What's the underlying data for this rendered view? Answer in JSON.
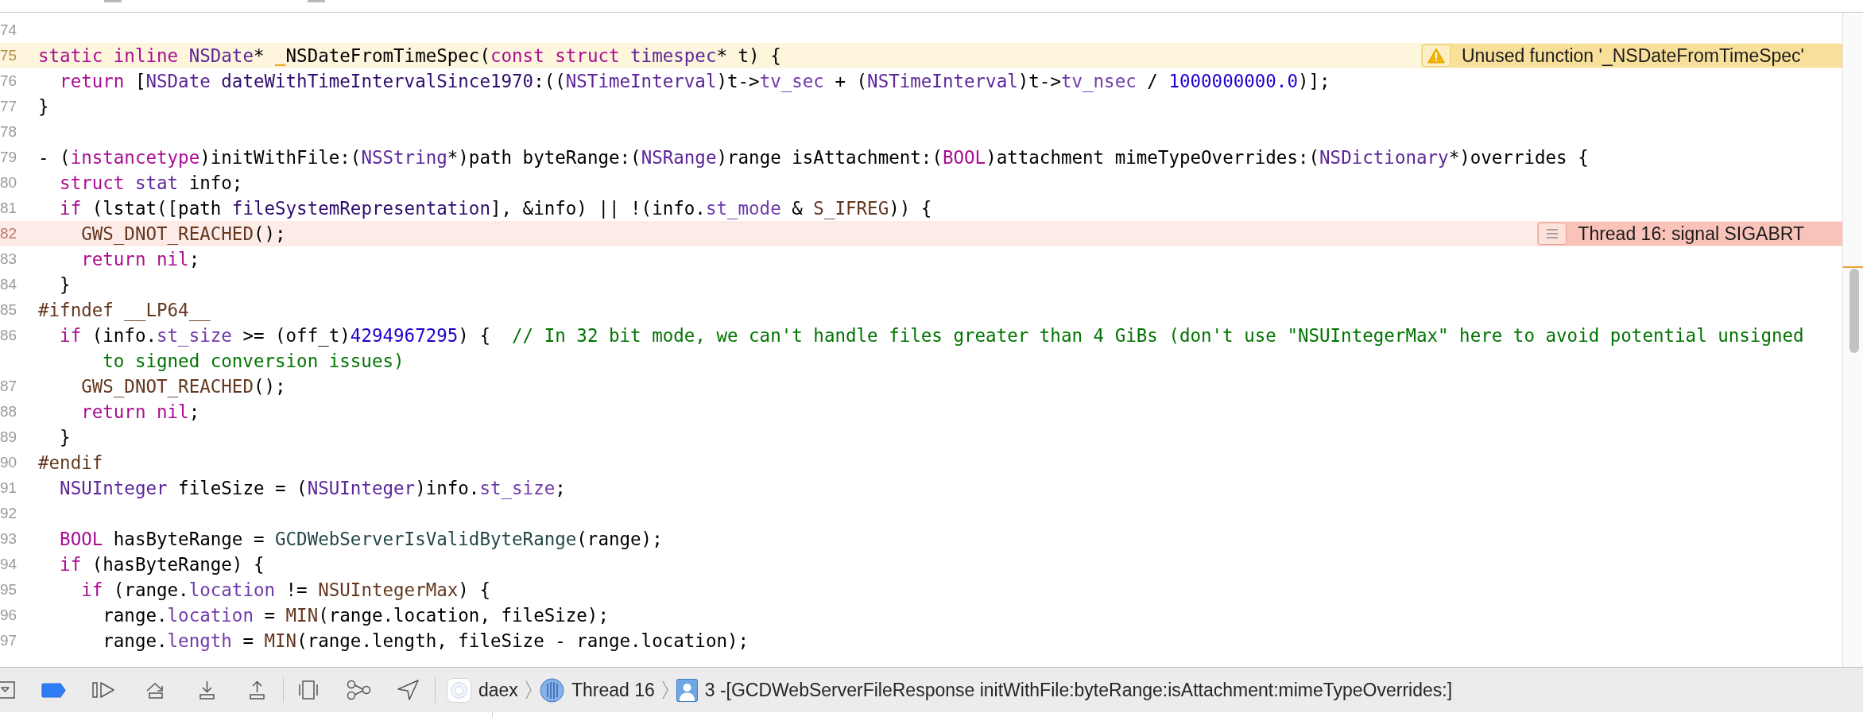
{
  "editor": {
    "lines": [
      {
        "number": "74"
      },
      {
        "number": "75",
        "issue": {
          "kind": "warning",
          "text": "Unused function '_NSDateFromTimeSpec'"
        },
        "tokens": [
          {
            "kind": "keyword",
            "text": "static "
          },
          {
            "kind": "keyword",
            "text": "inline "
          },
          {
            "kind": "type",
            "text": "NSDate"
          },
          {
            "kind": "plain",
            "text": "* "
          },
          {
            "kind": "issue_site",
            "text": "_NSDateFromTimeSpec"
          },
          {
            "kind": "plain",
            "text": "("
          },
          {
            "kind": "keyword",
            "text": "const "
          },
          {
            "kind": "keyword",
            "text": "struct "
          },
          {
            "kind": "type",
            "text": "timespec"
          },
          {
            "kind": "plain",
            "text": "* t) {"
          }
        ]
      },
      {
        "number": "76",
        "tokens": [
          {
            "kind": "keyword",
            "text": "  return"
          },
          {
            "kind": "plain",
            "text": " ["
          },
          {
            "kind": "type",
            "text": "NSDate "
          },
          {
            "kind": "method",
            "text": "dateWithTimeIntervalSince1970"
          },
          {
            "kind": "plain",
            "text": ":(("
          },
          {
            "kind": "type",
            "text": "NSTimeInterval"
          },
          {
            "kind": "plain",
            "text": ")t->"
          },
          {
            "kind": "member",
            "text": "tv_sec"
          },
          {
            "kind": "plain",
            "text": " + ("
          },
          {
            "kind": "type",
            "text": "NSTimeInterval"
          },
          {
            "kind": "plain",
            "text": ")t->"
          },
          {
            "kind": "member",
            "text": "tv_nsec"
          },
          {
            "kind": "plain",
            "text": " / "
          },
          {
            "kind": "number",
            "text": "1000000000.0"
          },
          {
            "kind": "plain",
            "text": ")];"
          }
        ]
      },
      {
        "number": "77",
        "tokens": [
          {
            "kind": "plain",
            "text": "}"
          }
        ]
      },
      {
        "number": "78"
      },
      {
        "number": "79",
        "tokens": [
          {
            "kind": "plain",
            "text": "- ("
          },
          {
            "kind": "keyword",
            "text": "instancetype"
          },
          {
            "kind": "plain",
            "text": ")initWithFile:("
          },
          {
            "kind": "type",
            "text": "NSString"
          },
          {
            "kind": "plain",
            "text": "*)path byteRange:("
          },
          {
            "kind": "type",
            "text": "NSRange"
          },
          {
            "kind": "plain",
            "text": ")range isAttachment:("
          },
          {
            "kind": "keyword",
            "text": "BOOL"
          },
          {
            "kind": "plain",
            "text": ")attachment mimeTypeOverrides:("
          },
          {
            "kind": "type",
            "text": "NSDictionary"
          },
          {
            "kind": "plain",
            "text": "*)overrides {"
          }
        ]
      },
      {
        "number": "80",
        "tokens": [
          {
            "kind": "keyword",
            "text": "  struct "
          },
          {
            "kind": "type",
            "text": "stat"
          },
          {
            "kind": "plain",
            "text": " info;"
          }
        ]
      },
      {
        "number": "81",
        "tokens": [
          {
            "kind": "keyword",
            "text": "  if"
          },
          {
            "kind": "plain",
            "text": " (lstat([path "
          },
          {
            "kind": "method",
            "text": "fileSystemRepresentation"
          },
          {
            "kind": "plain",
            "text": "], &info) || !(info."
          },
          {
            "kind": "member",
            "text": "st_mode"
          },
          {
            "kind": "plain",
            "text": " & "
          },
          {
            "kind": "macro",
            "text": "S_IFREG"
          },
          {
            "kind": "plain",
            "text": ")) {"
          }
        ]
      },
      {
        "number": "82",
        "issue": {
          "kind": "error",
          "text": "Thread 16: signal SIGABRT"
        },
        "tokens": [
          {
            "kind": "macro",
            "text": "    GWS_DNOT_REACHED"
          },
          {
            "kind": "plain",
            "text": "();"
          }
        ]
      },
      {
        "number": "83",
        "tokens": [
          {
            "kind": "keyword",
            "text": "    return "
          },
          {
            "kind": "keyword",
            "text": "nil"
          },
          {
            "kind": "plain",
            "text": ";"
          }
        ]
      },
      {
        "number": "84",
        "tokens": [
          {
            "kind": "plain",
            "text": "  }"
          }
        ]
      },
      {
        "number": "85",
        "tokens": [
          {
            "kind": "macro",
            "text": "#ifndef __LP64__"
          }
        ]
      },
      {
        "number": "86",
        "tokens": [
          {
            "kind": "keyword",
            "text": "  if"
          },
          {
            "kind": "plain",
            "text": " (info."
          },
          {
            "kind": "member",
            "text": "st_size"
          },
          {
            "kind": "plain",
            "text": " >= (off_t)"
          },
          {
            "kind": "number",
            "text": "4294967295"
          },
          {
            "kind": "plain",
            "text": ") {  "
          },
          {
            "kind": "comment",
            "text": "// In 32 bit mode, we can't handle files greater than 4 GiBs (don't use \"NSUIntegerMax\" here to avoid potential unsigned to signed conversion issues)"
          }
        ]
      },
      {
        "number": "87",
        "tokens": [
          {
            "kind": "macro",
            "text": "    GWS_DNOT_REACHED"
          },
          {
            "kind": "plain",
            "text": "();"
          }
        ]
      },
      {
        "number": "88",
        "tokens": [
          {
            "kind": "keyword",
            "text": "    return "
          },
          {
            "kind": "keyword",
            "text": "nil"
          },
          {
            "kind": "plain",
            "text": ";"
          }
        ]
      },
      {
        "number": "89",
        "tokens": [
          {
            "kind": "plain",
            "text": "  }"
          }
        ]
      },
      {
        "number": "90",
        "tokens": [
          {
            "kind": "macro",
            "text": "#endif"
          }
        ]
      },
      {
        "number": "91",
        "tokens": [
          {
            "kind": "type",
            "text": "  NSUInteger"
          },
          {
            "kind": "plain",
            "text": " fileSize = ("
          },
          {
            "kind": "type",
            "text": "NSUInteger"
          },
          {
            "kind": "plain",
            "text": ")info."
          },
          {
            "kind": "member",
            "text": "st_size"
          },
          {
            "kind": "plain",
            "text": ";"
          }
        ]
      },
      {
        "number": "92"
      },
      {
        "number": "93",
        "tokens": [
          {
            "kind": "keyword",
            "text": "  BOOL"
          },
          {
            "kind": "plain",
            "text": " hasByteRange = "
          },
          {
            "kind": "function",
            "text": "GCDWebServerIsValidByteRange"
          },
          {
            "kind": "plain",
            "text": "(range);"
          }
        ]
      },
      {
        "number": "94",
        "tokens": [
          {
            "kind": "keyword",
            "text": "  if"
          },
          {
            "kind": "plain",
            "text": " (hasByteRange) {"
          }
        ]
      },
      {
        "number": "95",
        "tokens": [
          {
            "kind": "keyword",
            "text": "    if"
          },
          {
            "kind": "plain",
            "text": " (range."
          },
          {
            "kind": "member",
            "text": "location"
          },
          {
            "kind": "plain",
            "text": " != "
          },
          {
            "kind": "macro",
            "text": "NSUIntegerMax"
          },
          {
            "kind": "plain",
            "text": ") {"
          }
        ]
      },
      {
        "number": "96",
        "tokens": [
          {
            "kind": "plain",
            "text": "      range."
          },
          {
            "kind": "member",
            "text": "location"
          },
          {
            "kind": "plain",
            "text": " = "
          },
          {
            "kind": "macro",
            "text": "MIN"
          },
          {
            "kind": "plain",
            "text": "(range.location, fileSize);"
          }
        ]
      },
      {
        "number": "97",
        "tokens": [
          {
            "kind": "plain",
            "text": "      range."
          },
          {
            "kind": "member",
            "text": "length"
          },
          {
            "kind": "plain",
            "text": " = "
          },
          {
            "kind": "macro",
            "text": "MIN"
          },
          {
            "kind": "plain",
            "text": "(range.length, fileSize - range.location);"
          }
        ]
      }
    ]
  },
  "debug_bar": {
    "breakpoints": {
      "on": true
    },
    "path": [
      {
        "kind": "app",
        "label": "daex"
      },
      {
        "kind": "thread",
        "label": "Thread 16"
      },
      {
        "kind": "frame",
        "label": "3 -[GCDWebServerFileResponse initWithFile:byteRange:isAttachment:mimeTypeOverrides:]"
      }
    ]
  }
}
